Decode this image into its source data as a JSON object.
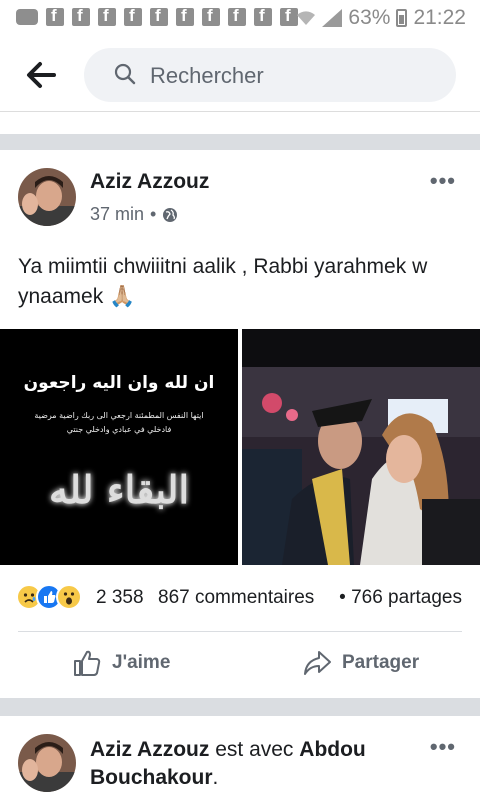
{
  "status_bar": {
    "battery": "63%",
    "time": "21:22",
    "icons": [
      "messenger-icon",
      "facebook-notification-icon",
      "wifi-icon",
      "signal-icon",
      "battery-icon"
    ]
  },
  "header": {
    "search_placeholder": "Rechercher",
    "icons": [
      "back-arrow-icon",
      "search-icon"
    ]
  },
  "post1": {
    "author": "Aziz Azzouz",
    "time": "37 min",
    "separator": "•",
    "audience_icon": "globe-icon",
    "text": "Ya miimtii chwiiitni aalik , Rabbi yarahmek w ynaamek",
    "emoji": "🙏🏼",
    "photo1": {
      "line1": "ان لله وان اليه راجعون",
      "line2": "ايتها النفس المطمئنة ارجعي الى ربك راضية مرضية",
      "line3": "فادخلي في عبادي وادخلي جنتي",
      "line4": "البقاء لله"
    },
    "reaction_icons": [
      "sad-reaction-icon",
      "like-reaction-icon",
      "wow-reaction-icon"
    ],
    "reaction_count": "2 358",
    "comments": "867 commentaires",
    "shares_separator": "•",
    "shares": "766 partages",
    "like_label": "J'aime",
    "share_label": "Partager"
  },
  "post2": {
    "author": "Aziz Azzouz",
    "with_text": " est avec ",
    "tagged": "Abdou Bouchakour",
    "end": "."
  },
  "colors": {
    "text": "#1c1e21",
    "secondary": "#606770",
    "divider": "#dadde1",
    "search_bg": "#f0f2f5",
    "like_blue": "#1877f2"
  }
}
